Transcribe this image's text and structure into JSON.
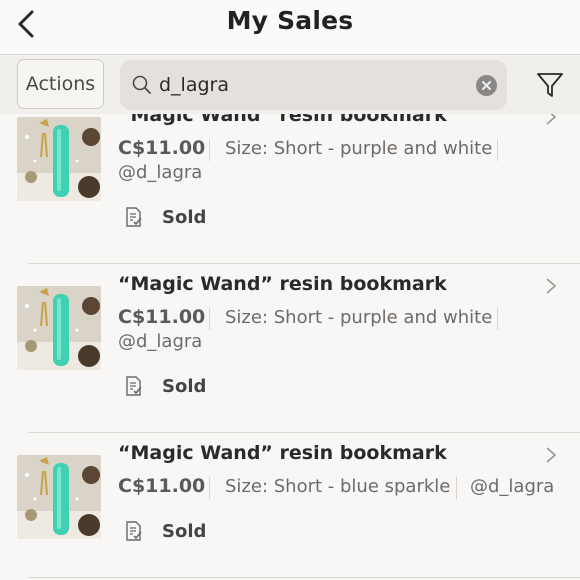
{
  "header": {
    "title": "My Sales"
  },
  "toolbar": {
    "actions_label": "Actions",
    "search_value": "d_lagra"
  },
  "items": [
    {
      "title": "“Magic Wand” resin bookmark",
      "price": "C$11.00",
      "size": "Size: Short - purple and white",
      "buyer": "@d_lagra",
      "status": "Sold"
    },
    {
      "title": "“Magic Wand” resin bookmark",
      "price": "C$11.00",
      "size": "Size: Short - purple and white",
      "buyer": "@d_lagra",
      "status": "Sold"
    },
    {
      "title": "“Magic Wand” resin bookmark",
      "price": "C$11.00",
      "size": "Size: Short - blue sparkle",
      "buyer": "@d_lagra",
      "status": "Sold"
    }
  ],
  "colors": {
    "thumb_green": "#3fd1b2",
    "accent_gold": "#c8a24a",
    "text_dark": "#2a2a2a"
  }
}
